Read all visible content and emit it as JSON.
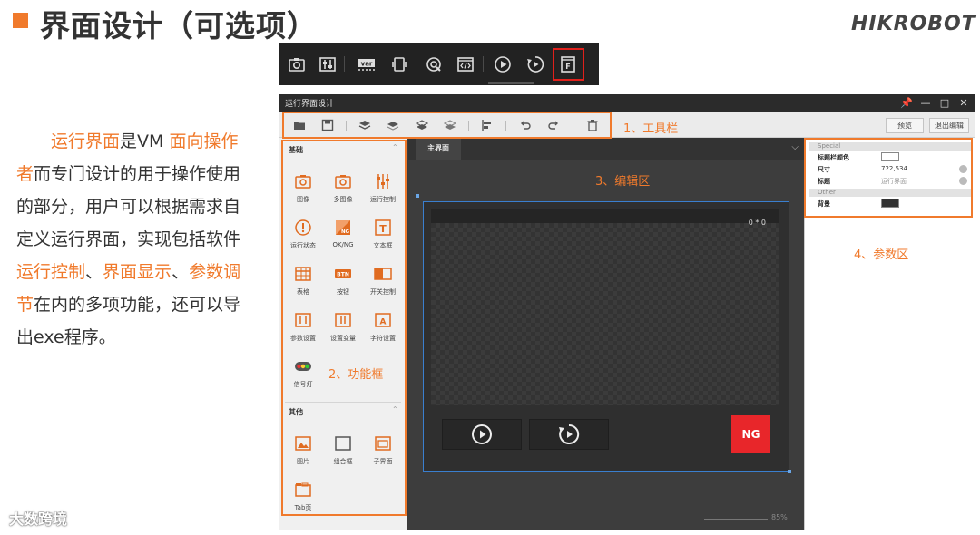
{
  "slide": {
    "title": "界面设计（可选项）",
    "brand": "HIKROBOT",
    "watermark": "大数跨境"
  },
  "description": {
    "parts": [
      {
        "text": "运行界面",
        "highlight": true
      },
      {
        "text": "是VM ",
        "highlight": false
      },
      {
        "text": "面向操作者",
        "highlight": true
      },
      {
        "text": "而专门设计的用于操作使用的部分，用户可以根据需求自定义运行界面，实现包括软件",
        "highlight": false
      },
      {
        "text": "运行控制",
        "highlight": true
      },
      {
        "text": "、",
        "highlight": false
      },
      {
        "text": "界面显示",
        "highlight": true
      },
      {
        "text": "、",
        "highlight": false
      },
      {
        "text": "参数调节",
        "highlight": true
      },
      {
        "text": "在内的多项功能，还可以导出exe程序。",
        "highlight": false
      }
    ]
  },
  "icon_strip": {
    "icons": [
      "camera-icon",
      "adjust-sliders-icon",
      "var-icon",
      "device-icon",
      "target-icon",
      "code-icon",
      "play-circle-icon",
      "run-once-icon",
      "form-f-icon"
    ],
    "var_text": "var",
    "highlighted": "form-f-icon"
  },
  "window": {
    "title": "运行界面设计",
    "controls": [
      "pin-icon",
      "minimize-icon",
      "maximize-icon",
      "close-icon"
    ],
    "toolbar": {
      "icons": [
        "open-folder-icon",
        "save-icon",
        "layer-top-icon",
        "layer-up-icon",
        "layer-down-icon",
        "layer-bottom-icon",
        "align-icon",
        "undo-icon",
        "redo-icon",
        "delete-icon"
      ],
      "preview_label": "预览",
      "exit_label": "退出编辑"
    },
    "left_panel": {
      "section_basic": "基础",
      "basic_items": [
        {
          "label": "图像",
          "icon": "image-camera-icon"
        },
        {
          "label": "多图像",
          "icon": "multi-image-icon"
        },
        {
          "label": "运行控制",
          "icon": "run-control-icon"
        },
        {
          "label": "运行状态",
          "icon": "run-status-icon"
        },
        {
          "label": "OK/NG",
          "icon": "ok-ng-icon"
        },
        {
          "label": "文本框",
          "icon": "textbox-icon"
        },
        {
          "label": "表格",
          "icon": "table-icon"
        },
        {
          "label": "按钮",
          "icon": "button-icon"
        },
        {
          "label": "开关控制",
          "icon": "switch-icon"
        },
        {
          "label": "参数设置",
          "icon": "param-setting-icon"
        },
        {
          "label": "设置变量",
          "icon": "set-variable-icon"
        },
        {
          "label": "字符设置",
          "icon": "char-setting-icon"
        },
        {
          "label": "信号灯",
          "icon": "signal-light-icon"
        }
      ],
      "btn_icon_text": "BTN",
      "ng_icon_text": "NG",
      "section_other": "其他",
      "other_items": [
        {
          "label": "图片",
          "icon": "picture-icon"
        },
        {
          "label": "组合框",
          "icon": "group-box-icon"
        },
        {
          "label": "子界面",
          "icon": "sub-interface-icon"
        },
        {
          "label": "Tab页",
          "icon": "tab-page-icon"
        }
      ]
    },
    "canvas": {
      "tab_label": "主界面",
      "coord": "0 * 0",
      "ng_label": "NG",
      "zoom": "85%"
    },
    "right_panel": {
      "groups": [
        {
          "name": "Special",
          "rows": [
            {
              "name": "标题栏颜色",
              "value": "",
              "kind": "color-white"
            },
            {
              "name": "尺寸",
              "value": "722,534",
              "kind": "text"
            },
            {
              "name": "标题",
              "value": "运行界面",
              "kind": "text-muted"
            }
          ]
        },
        {
          "name": "Other",
          "rows": [
            {
              "name": "背景",
              "value": "",
              "kind": "color-dark"
            }
          ]
        }
      ]
    }
  },
  "annotations": {
    "toolbar": "1、工具栏",
    "function_box": "2、功能框",
    "edit_area": "3、编辑区",
    "param_area": "4、参数区"
  },
  "colors": {
    "accent": "#f07a2c",
    "highlight_red": "#e0201b",
    "ng_red": "#e8262a",
    "selection_blue": "#3a7fcf"
  }
}
